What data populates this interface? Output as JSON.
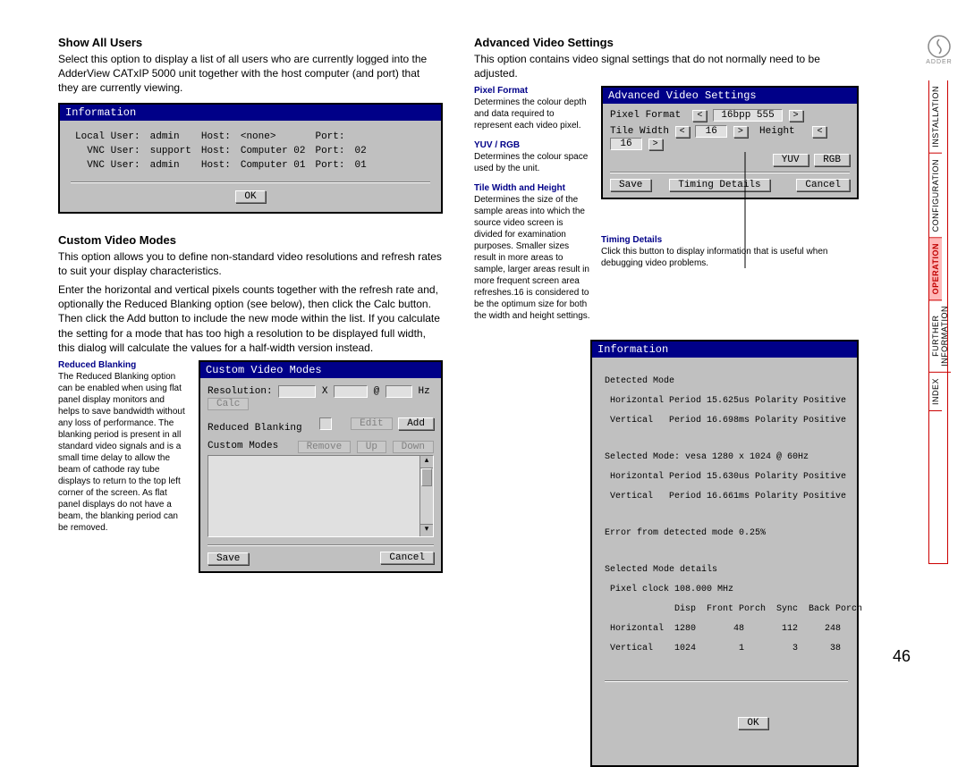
{
  "pageNumber": "46",
  "logoText": "ADDER",
  "sidenav": {
    "installation": "INSTALLATION",
    "configuration": "CONFIGURATION",
    "operation": "OPERATION",
    "further": "FURTHER\nINFORMATION",
    "index": "INDEX"
  },
  "showAllUsers": {
    "heading": "Show All Users",
    "body": "Select this option to display a list of all users who are currently logged into the AdderView CATxIP 5000 unit together with the host computer (and port) that they are currently viewing.",
    "dlgTitle": "Information",
    "rows": [
      {
        "c1": "Local User:",
        "c2": "admin",
        "c3": "Host:",
        "c4": "<none>",
        "c5": "Port:",
        "c6": ""
      },
      {
        "c1": "VNC User:",
        "c2": "support",
        "c3": "Host:",
        "c4": "Computer 02",
        "c5": "Port:",
        "c6": "02"
      },
      {
        "c1": "VNC User:",
        "c2": "admin",
        "c3": "Host:",
        "c4": "Computer 01",
        "c5": "Port:",
        "c6": "01"
      }
    ],
    "ok": "OK"
  },
  "customVideo": {
    "heading": "Custom Video Modes",
    "p1": "This option allows you to define non-standard video resolutions and refresh rates to suit your display characteristics.",
    "p2": "Enter the horizontal and vertical pixels counts together with the refresh rate and, optionally the Reduced Blanking option (see below), then click the Calc button. Then click the Add button to include the new mode within the list. If you calculate the setting for a mode that has too high a resolution to be displayed full width, this dialog will calculate the values for a half-width version instead.",
    "sideTitle": "Reduced Blanking",
    "sideBody": "The Reduced Blanking option can be enabled when using flat panel display monitors and helps to save bandwidth without any loss of performance. The blanking period is present in all standard video signals and is a small time delay to allow the beam of cathode ray tube displays to return to the top left corner of the screen. As flat panel displays do not have a beam, the blanking period can be removed.",
    "dlgTitle": "Custom Video Modes",
    "resLabel": "Resolution:",
    "x": "X",
    "at": "@",
    "hz": "Hz",
    "calc": "Calc",
    "rbLabel": "Reduced Blanking",
    "edit": "Edit",
    "add": "Add",
    "cmLabel": "Custom Modes",
    "remove": "Remove",
    "up": "Up",
    "down": "Down",
    "save": "Save",
    "cancel": "Cancel"
  },
  "advanced": {
    "heading": "Advanced Video Settings",
    "body": "This option contains video signal settings that do not normally need to be adjusted.",
    "pixelTitle": "Pixel Format",
    "pixelBody": "Determines the colour depth and data required to represent each video pixel.",
    "yuvTitle": "YUV / RGB",
    "yuvBody": "Determines the colour space used by the unit.",
    "tileTitle": "Tile Width and Height",
    "tileBody": "Determines the size of the sample areas into which the source video screen is divided for examination purposes. Smaller sizes result in more areas to sample, larger areas result in more frequent screen area refreshes.16 is considered to be the optimum size for both the width and height settings.",
    "timingTitle": "Timing Details",
    "timingBody": "Click this button to display information that is useful when debugging video problems.",
    "dlgTitle": "Advanced Video Settings",
    "pfLabel": "Pixel Format",
    "pfValue": "16bpp 555",
    "twLabel": "Tile Width",
    "twValue": "16",
    "hLabel": "Height",
    "hValue": "16",
    "yuv": "YUV",
    "rgb": "RGB",
    "save": "Save",
    "td": "Timing Details",
    "cancel": "Cancel"
  },
  "info2": {
    "title": "Information",
    "l1": "Detected Mode",
    "l2": " Horizontal Period 15.625us Polarity Positive",
    "l3": " Vertical   Period 16.698ms Polarity Positive",
    "l4": "Selected Mode: vesa 1280 x 1024 @ 60Hz",
    "l5": " Horizontal Period 15.630us Polarity Positive",
    "l6": " Vertical   Period 16.661ms Polarity Positive",
    "l7": "Error from detected mode 0.25%",
    "l8": "Selected Mode details",
    "l9": " Pixel clock 108.000 MHz",
    "lh": "             Disp  Front Porch  Sync  Back Porch",
    "la": " Horizontal  1280       48       112     248",
    "lb": " Vertical    1024        1         3      38",
    "ok": "OK"
  }
}
